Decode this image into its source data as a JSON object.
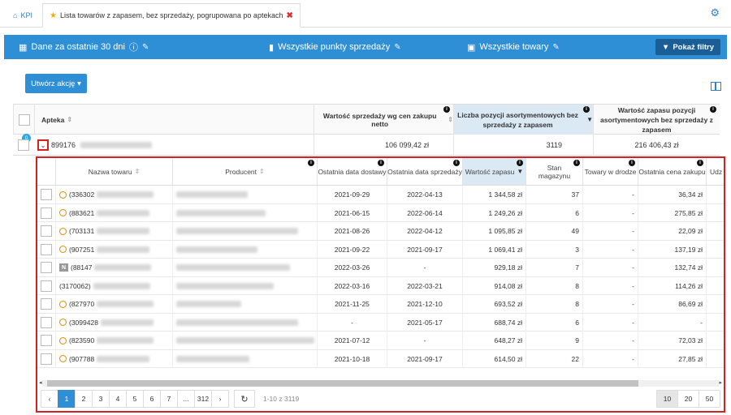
{
  "tabs": {
    "kpi": "KPI",
    "active": "Lista towarów z zapasem, bez sprzedaży, pogrupowana po aptekach"
  },
  "filters": {
    "period": "Dane za ostatnie 30 dni",
    "points": "Wszystkie punkty sprzedaży",
    "products": "Wszystkie towary",
    "show_filters": "Pokaż filtry"
  },
  "create_action": "Utwórz akcję",
  "outer": {
    "headers": {
      "apteka": "Apteka",
      "wartosc": "Wartość sprzedaży wg cen zakupu netto",
      "liczba": "Liczba pozycji asortymentowych bez sprzedaży z zapasem",
      "zapas": "Wartość zapasu pozycji asortymentowych bez sprzedaży z zapasem"
    },
    "badge": "0",
    "row": {
      "code": "899176",
      "wartosc": "106 099,42 zł",
      "liczba": "3119",
      "zapas": "216 406,43 zł"
    }
  },
  "nested": {
    "headers": {
      "nazwa": "Nazwa towaru",
      "producent": "Producent",
      "dostawa": "Ostatnia data dostawy",
      "sprzedaz": "Ostatnia data sprzedaży",
      "wartosc": "Wartość zapasu",
      "stan": "Stan magazynu",
      "droga": "Towary w drodze",
      "cena": "Ostatnia cena zakupu",
      "udz": "Udz"
    },
    "rows": [
      {
        "id": "(336302",
        "dostawa": "2021-09-29",
        "sprzedaz": "2022-04-13",
        "wartosc": "1 344,58 zł",
        "stan": "37",
        "droga": "-",
        "cena": "36,34 zł"
      },
      {
        "id": "(883621",
        "dostawa": "2021-06-15",
        "sprzedaz": "2022-06-14",
        "wartosc": "1 249,26 zł",
        "stan": "6",
        "droga": "-",
        "cena": "275,85 zł"
      },
      {
        "id": "(703131",
        "dostawa": "2021-08-26",
        "sprzedaz": "2022-04-12",
        "wartosc": "1 095,85 zł",
        "stan": "49",
        "droga": "-",
        "cena": "22,09 zł"
      },
      {
        "id": "(907251",
        "dostawa": "2021-09-22",
        "sprzedaz": "2021-09-17",
        "wartosc": "1 069,41 zł",
        "stan": "3",
        "droga": "-",
        "cena": "137,19 zł"
      },
      {
        "id": "(88147",
        "dostawa": "2022-03-26",
        "sprzedaz": "-",
        "wartosc": "929,18 zł",
        "stan": "7",
        "droga": "-",
        "cena": "132,74 zł"
      },
      {
        "id": "(3170062)",
        "dostawa": "2022-03-16",
        "sprzedaz": "2022-03-21",
        "wartosc": "914,08 zł",
        "stan": "8",
        "droga": "-",
        "cena": "114,26 zł"
      },
      {
        "id": "(827970",
        "dostawa": "2021-11-25",
        "sprzedaz": "2021-12-10",
        "wartosc": "693,52 zł",
        "stan": "8",
        "droga": "-",
        "cena": "86,69 zł"
      },
      {
        "id": "(3099428",
        "dostawa": "-",
        "sprzedaz": "2021-05-17",
        "wartosc": "688,74 zł",
        "stan": "6",
        "droga": "-",
        "cena": "-"
      },
      {
        "id": "(823590",
        "dostawa": "2021-07-12",
        "sprzedaz": "-",
        "wartosc": "648,27 zł",
        "stan": "9",
        "droga": "-",
        "cena": "72,03 zł"
      },
      {
        "id": "(907788",
        "dostawa": "2021-10-18",
        "sprzedaz": "2021-09-17",
        "wartosc": "614,50 zł",
        "stan": "22",
        "droga": "-",
        "cena": "27,85 zł"
      }
    ],
    "row_badge": "N",
    "pager": {
      "prev": "‹",
      "pages": [
        "1",
        "2",
        "3",
        "4",
        "5",
        "6",
        "7"
      ],
      "ellipsis": "…",
      "last": "312",
      "next": "›",
      "info": "1-10 z 3119",
      "sizes": [
        "10",
        "20",
        "50"
      ]
    }
  }
}
